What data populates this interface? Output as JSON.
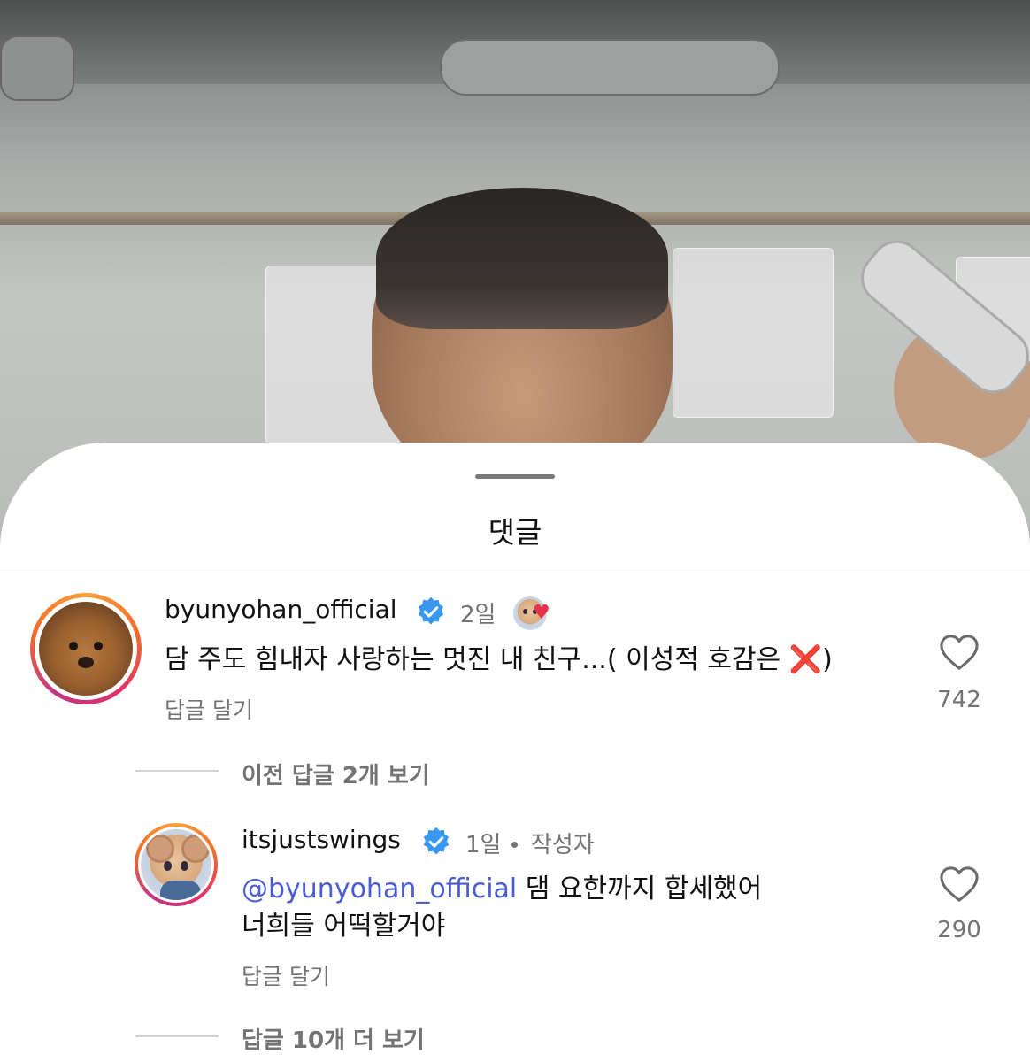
{
  "sheet": {
    "title": "댓글"
  },
  "comments": [
    {
      "username": "byunyohan_official",
      "time": "2일",
      "text": "담 주도 힘내자 사랑하는 멋진 내 친구...( 이성적 호감은 ",
      "emoji": "❌",
      "text_end": ")",
      "reply_label": "답글 달기",
      "likes": "742"
    }
  ],
  "thread": {
    "view_previous": "이전 답글 2개 보기"
  },
  "reply": {
    "username": "itsjustswings",
    "time": "1일",
    "author_tag": "작성자",
    "mention": "@byunyohan_official",
    "text_line1": " 댐 요한까지 합세했어",
    "text_line2": "너희들 어떡할거야",
    "reply_label": "답글 달기",
    "likes": "290"
  },
  "more_replies": "답글 10개 더 보기",
  "icons": {
    "verified": "verified-badge-icon",
    "heart": "heart-outline-icon",
    "liked_by_creator": "creator-heart-icon"
  },
  "colors": {
    "verified": "#3897f0",
    "mention": "#4a5bd6",
    "muted": "#737373"
  }
}
